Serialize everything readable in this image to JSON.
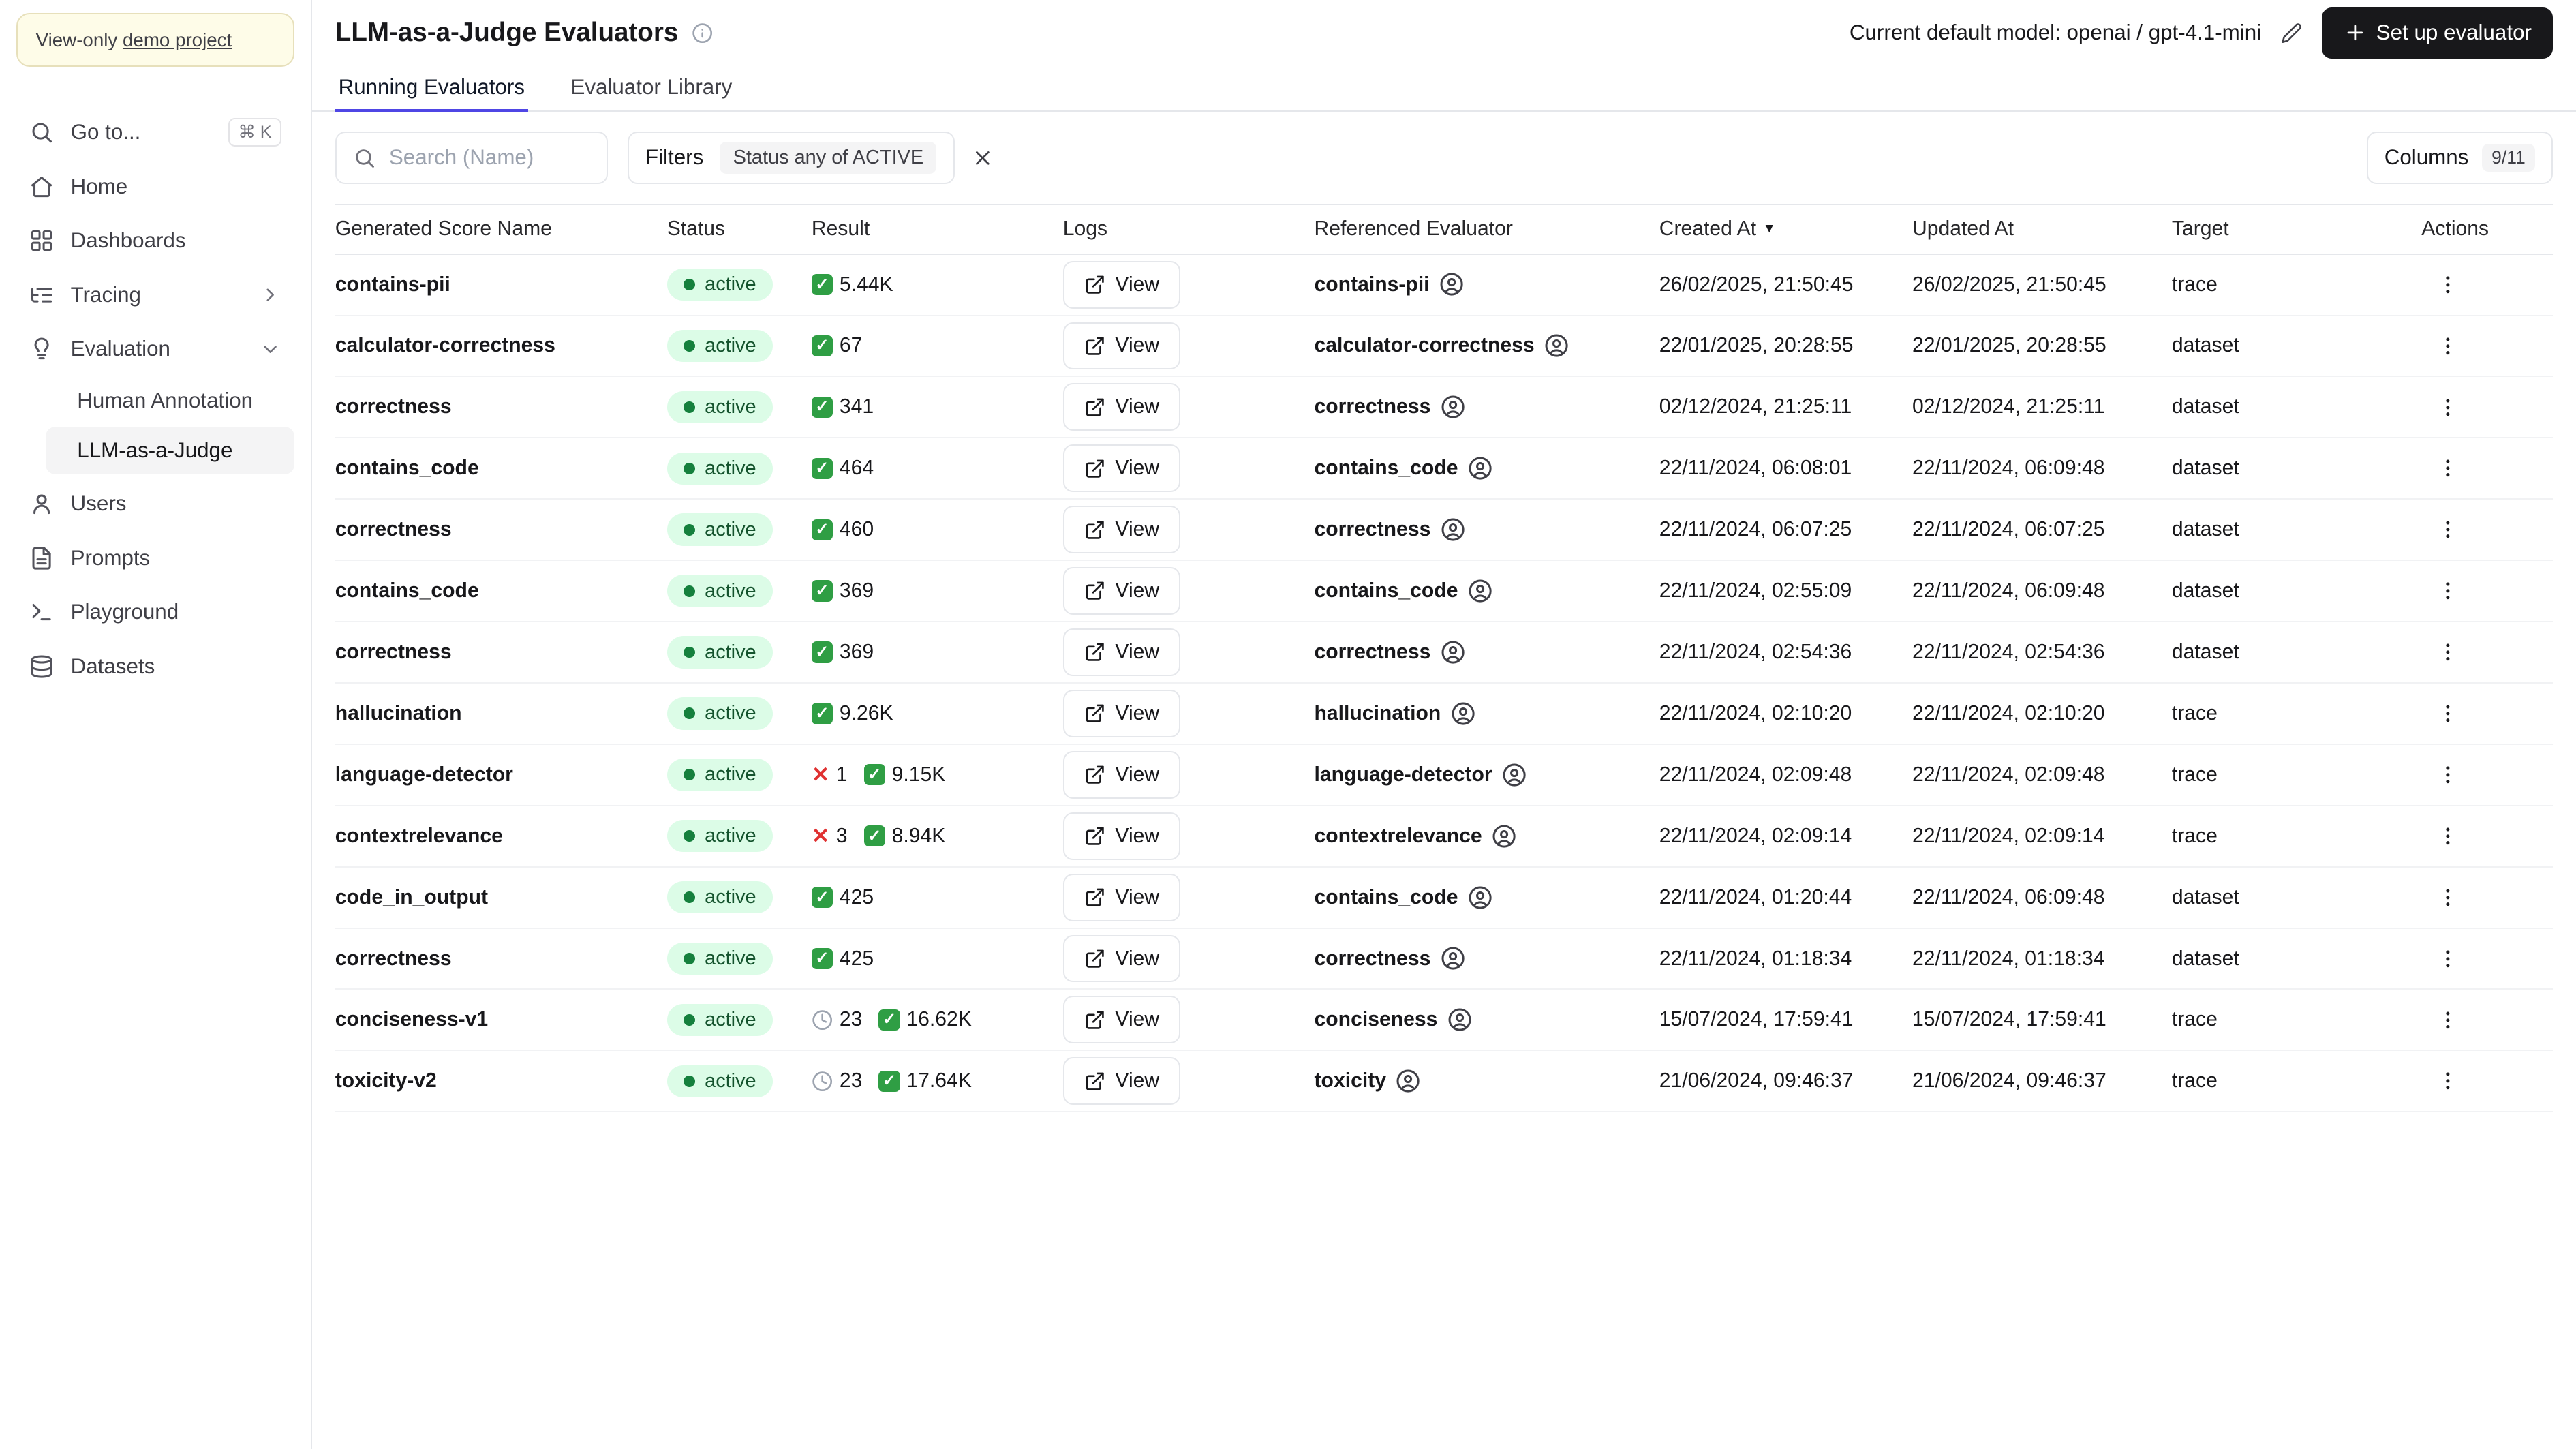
{
  "colors": {
    "accent_tab": "#4f46e5",
    "primary_button_bg": "#18181b",
    "status_active_bg": "#dcfce7",
    "status_active_dot": "#15803d",
    "success_green": "#2f9e44",
    "error_red": "#e03131",
    "pending_gray": "#9ca3af",
    "banner_bg": "#fefce8"
  },
  "icons": {
    "check": "✓",
    "cross": "✕",
    "sort_desc": "▼",
    "search": "magnifier",
    "info": "circle-i",
    "edit": "pencil",
    "add": "plus",
    "external_link": "box-arrow",
    "user_circle": "person-in-circle",
    "kebab": "vertical-dots",
    "pending": "clock",
    "clear": "x"
  },
  "sidebar": {
    "banner": {
      "text": "View-only ",
      "link": "demo project"
    },
    "goto": {
      "label": "Go to...",
      "shortcut": "⌘ K"
    },
    "items": [
      {
        "label": "Home"
      },
      {
        "label": "Dashboards"
      },
      {
        "label": "Tracing"
      },
      {
        "label": "Evaluation"
      },
      {
        "label": "Users"
      },
      {
        "label": "Prompts"
      },
      {
        "label": "Playground"
      },
      {
        "label": "Datasets"
      }
    ],
    "evaluation_children": [
      {
        "label": "Human Annotation"
      },
      {
        "label": "LLM-as-a-Judge"
      }
    ]
  },
  "header": {
    "title": "LLM-as-a-Judge Evaluators",
    "default_model_label": "Current default model: openai / gpt-4.1-mini",
    "setup_button_label": "Set up evaluator"
  },
  "tabs": [
    {
      "label": "Running Evaluators",
      "active": true
    },
    {
      "label": "Evaluator Library",
      "active": false
    }
  ],
  "toolbar": {
    "search_placeholder": "Search (Name)",
    "filters_label": "Filters",
    "filter_chip": "Status any of ACTIVE",
    "columns_label": "Columns",
    "columns_badge": "9/11"
  },
  "table": {
    "view_button_label": "View",
    "columns": [
      {
        "label": "Generated Score Name",
        "interactable": true
      },
      {
        "label": "Status",
        "interactable": true
      },
      {
        "label": "Result",
        "interactable": true
      },
      {
        "label": "Logs",
        "interactable": true
      },
      {
        "label": "Referenced Evaluator",
        "interactable": true
      },
      {
        "label": "Created At",
        "sorted": "desc",
        "interactable": true
      },
      {
        "label": "Updated At",
        "interactable": true
      },
      {
        "label": "Target",
        "interactable": true
      },
      {
        "label": "Actions",
        "interactable": false
      }
    ],
    "rows": [
      {
        "name": "contains-pii",
        "status": "active",
        "results": [
          {
            "type": "check",
            "count": "5.44K"
          }
        ],
        "evaluator": "contains-pii",
        "created": "26/02/2025, 21:50:45",
        "updated": "26/02/2025, 21:50:45",
        "target": "trace"
      },
      {
        "name": "calculator-correctness",
        "status": "active",
        "results": [
          {
            "type": "check",
            "count": "67"
          }
        ],
        "evaluator": "calculator-correctness",
        "created": "22/01/2025, 20:28:55",
        "updated": "22/01/2025, 20:28:55",
        "target": "dataset"
      },
      {
        "name": "correctness",
        "status": "active",
        "results": [
          {
            "type": "check",
            "count": "341"
          }
        ],
        "evaluator": "correctness",
        "created": "02/12/2024, 21:25:11",
        "updated": "02/12/2024, 21:25:11",
        "target": "dataset"
      },
      {
        "name": "contains_code",
        "status": "active",
        "results": [
          {
            "type": "check",
            "count": "464"
          }
        ],
        "evaluator": "contains_code",
        "created": "22/11/2024, 06:08:01",
        "updated": "22/11/2024, 06:09:48",
        "target": "dataset"
      },
      {
        "name": "correctness",
        "status": "active",
        "results": [
          {
            "type": "check",
            "count": "460"
          }
        ],
        "evaluator": "correctness",
        "created": "22/11/2024, 06:07:25",
        "updated": "22/11/2024, 06:07:25",
        "target": "dataset"
      },
      {
        "name": "contains_code",
        "status": "active",
        "results": [
          {
            "type": "check",
            "count": "369"
          }
        ],
        "evaluator": "contains_code",
        "created": "22/11/2024, 02:55:09",
        "updated": "22/11/2024, 06:09:48",
        "target": "dataset"
      },
      {
        "name": "correctness",
        "status": "active",
        "results": [
          {
            "type": "check",
            "count": "369"
          }
        ],
        "evaluator": "correctness",
        "created": "22/11/2024, 02:54:36",
        "updated": "22/11/2024, 02:54:36",
        "target": "dataset"
      },
      {
        "name": "hallucination",
        "status": "active",
        "results": [
          {
            "type": "check",
            "count": "9.26K"
          }
        ],
        "evaluator": "hallucination",
        "created": "22/11/2024, 02:10:20",
        "updated": "22/11/2024, 02:10:20",
        "target": "trace"
      },
      {
        "name": "language-detector",
        "status": "active",
        "results": [
          {
            "type": "x",
            "count": "1"
          },
          {
            "type": "check",
            "count": "9.15K"
          }
        ],
        "evaluator": "language-detector",
        "created": "22/11/2024, 02:09:48",
        "updated": "22/11/2024, 02:09:48",
        "target": "trace"
      },
      {
        "name": "contextrelevance",
        "status": "active",
        "results": [
          {
            "type": "x",
            "count": "3"
          },
          {
            "type": "check",
            "count": "8.94K"
          }
        ],
        "evaluator": "contextrelevance",
        "created": "22/11/2024, 02:09:14",
        "updated": "22/11/2024, 02:09:14",
        "target": "trace"
      },
      {
        "name": "code_in_output",
        "status": "active",
        "results": [
          {
            "type": "check",
            "count": "425"
          }
        ],
        "evaluator": "contains_code",
        "created": "22/11/2024, 01:20:44",
        "updated": "22/11/2024, 06:09:48",
        "target": "dataset"
      },
      {
        "name": "correctness",
        "status": "active",
        "results": [
          {
            "type": "check",
            "count": "425"
          }
        ],
        "evaluator": "correctness",
        "created": "22/11/2024, 01:18:34",
        "updated": "22/11/2024, 01:18:34",
        "target": "dataset"
      },
      {
        "name": "conciseness-v1",
        "status": "active",
        "results": [
          {
            "type": "pending",
            "count": "23"
          },
          {
            "type": "check",
            "count": "16.62K"
          }
        ],
        "evaluator": "conciseness",
        "created": "15/07/2024, 17:59:41",
        "updated": "15/07/2024, 17:59:41",
        "target": "trace"
      },
      {
        "name": "toxicity-v2",
        "status": "active",
        "results": [
          {
            "type": "pending",
            "count": "23"
          },
          {
            "type": "check",
            "count": "17.64K"
          }
        ],
        "evaluator": "toxicity",
        "created": "21/06/2024, 09:46:37",
        "updated": "21/06/2024, 09:46:37",
        "target": "trace"
      }
    ]
  }
}
